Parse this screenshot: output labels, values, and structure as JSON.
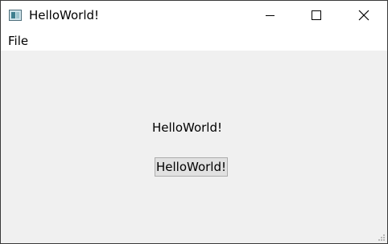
{
  "window": {
    "title": "HelloWorld!",
    "icon": "app-window-icon",
    "caption_buttons": [
      "minimize-icon",
      "maximize-icon",
      "close-icon"
    ]
  },
  "menubar": {
    "items": [
      {
        "label": "File"
      }
    ]
  },
  "main": {
    "label_text": "HelloWorld!",
    "button_label": "HelloWorld!"
  },
  "colors": {
    "titlebar_bg": "#ffffff",
    "client_bg": "#f0f0f0",
    "button_bg": "#e1e1e1",
    "button_border": "#adadad",
    "window_border": "#3a3a3a"
  }
}
